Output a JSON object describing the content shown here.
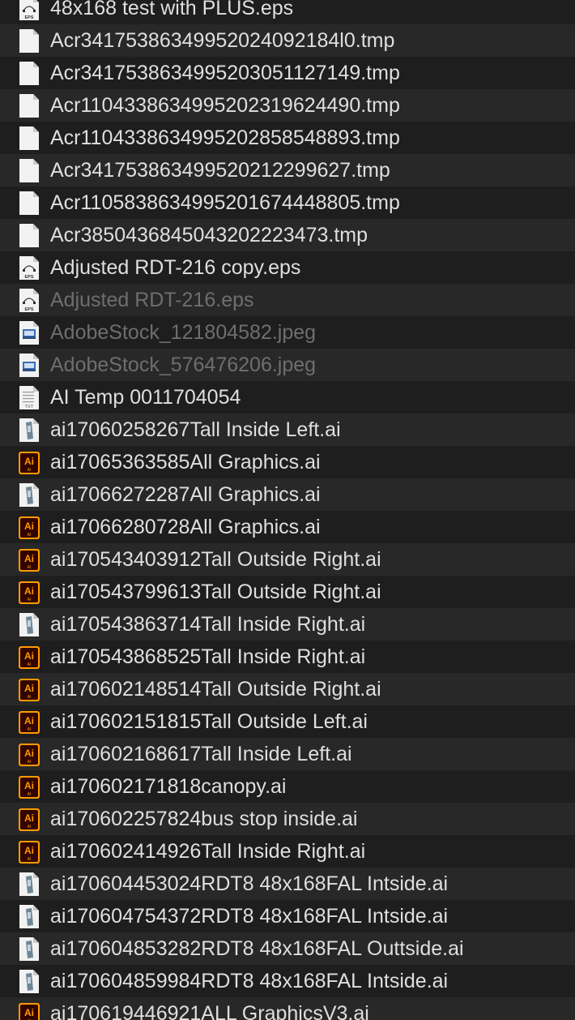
{
  "colors": {
    "background": "#1e1e1e",
    "row_alt": "#282828",
    "text": "#dfdfdf",
    "text_dim": "#6e6e6e",
    "ai_icon_bg": "#310400",
    "ai_icon_accent": "#ff9a00"
  },
  "files": [
    {
      "name": "48x168 test with PLUS.eps",
      "icon": "eps-file-icon",
      "badge": "EPS",
      "dim": false
    },
    {
      "name": "Acr34175386349952024092184l0.tmp",
      "icon": "blank-document-icon",
      "badge": "",
      "dim": false
    },
    {
      "name": "Acr341753863499520305112714​9.tmp",
      "icon": "blank-document-icon",
      "badge": "",
      "dim": false
    },
    {
      "name": "Acr110433863499520231962449​0.tmp",
      "icon": "blank-document-icon",
      "badge": "",
      "dim": false
    },
    {
      "name": "Acr110433863499520285854889​3.tmp",
      "icon": "blank-document-icon",
      "badge": "",
      "dim": false
    },
    {
      "name": "Acr34175386349952021229962​7.tmp",
      "icon": "blank-document-icon",
      "badge": "",
      "dim": false
    },
    {
      "name": "Acr110583863499520167444880​5.tmp",
      "icon": "blank-document-icon",
      "badge": "",
      "dim": false
    },
    {
      "name": "Acr38504368450432022234​73.tmp",
      "icon": "blank-document-icon",
      "badge": "",
      "dim": false
    },
    {
      "name": "Adjusted RDT-216 copy.eps",
      "icon": "eps-file-icon",
      "badge": "EPS",
      "dim": false
    },
    {
      "name": "Adjusted RDT-216.eps",
      "icon": "eps-file-icon",
      "badge": "EPS",
      "dim": true
    },
    {
      "name": "AdobeStock_121804582.jpeg",
      "icon": "image-file-icon",
      "badge": "",
      "dim": true
    },
    {
      "name": "AdobeStock_576476206.jpeg",
      "icon": "image-file-icon",
      "badge": "",
      "dim": true
    },
    {
      "name": "AI Temp 0011704054",
      "icon": "text-file-icon",
      "badge": "TXT",
      "dim": false
    },
    {
      "name": "ai17060258267Tall Inside Left.ai",
      "icon": "ai-thumbnail-icon",
      "badge": "",
      "dim": false
    },
    {
      "name": "ai17065363585All Graphics.ai",
      "icon": "illustrator-file-icon",
      "badge": "Ai",
      "dim": false
    },
    {
      "name": "ai17066272287All Graphics.ai",
      "icon": "ai-thumbnail-icon",
      "badge": "",
      "dim": false
    },
    {
      "name": "ai17066280728All Graphics.ai",
      "icon": "illustrator-file-icon",
      "badge": "Ai",
      "dim": false
    },
    {
      "name": "ai170543403912Tall Outside Right.ai",
      "icon": "illustrator-file-icon",
      "badge": "Ai",
      "dim": false
    },
    {
      "name": "ai170543799613Tall Outside Right.ai",
      "icon": "illustrator-file-icon",
      "badge": "Ai",
      "dim": false
    },
    {
      "name": "ai170543863714Tall Inside Right.ai",
      "icon": "ai-thumbnail-icon",
      "badge": "",
      "dim": false
    },
    {
      "name": "ai170543868525Tall Inside Right.ai",
      "icon": "illustrator-file-icon",
      "badge": "Ai",
      "dim": false
    },
    {
      "name": "ai170602148514Tall Outside Right.ai",
      "icon": "illustrator-file-icon",
      "badge": "Ai",
      "dim": false
    },
    {
      "name": "ai170602151815Tall Outside Left.ai",
      "icon": "illustrator-file-icon",
      "badge": "Ai",
      "dim": false
    },
    {
      "name": "ai170602168617Tall Inside Left.ai",
      "icon": "illustrator-file-icon",
      "badge": "Ai",
      "dim": false
    },
    {
      "name": "ai170602171818canopy.ai",
      "icon": "illustrator-file-icon",
      "badge": "Ai",
      "dim": false
    },
    {
      "name": "ai170602257824bus stop inside.ai",
      "icon": "illustrator-file-icon",
      "badge": "Ai",
      "dim": false
    },
    {
      "name": "ai170602414926Tall Inside Right.ai",
      "icon": "illustrator-file-icon",
      "badge": "Ai",
      "dim": false
    },
    {
      "name": "ai170604453024RDT8 48x168FAL Intside.ai",
      "icon": "ai-thumbnail-icon",
      "badge": "",
      "dim": false
    },
    {
      "name": "ai170604754372RDT8 48x168FAL Intside.ai",
      "icon": "ai-thumbnail-icon",
      "badge": "",
      "dim": false
    },
    {
      "name": "ai170604853282RDT8 48x168FAL Outtside.ai",
      "icon": "ai-thumbnail-icon",
      "badge": "",
      "dim": false
    },
    {
      "name": "ai170604859984RDT8 48x168FAL Intside.ai",
      "icon": "ai-thumbnail-icon",
      "badge": "",
      "dim": false
    },
    {
      "name": "ai170619446921ALL GraphicsV3.ai",
      "icon": "illustrator-file-icon",
      "badge": "Ai",
      "dim": false
    }
  ]
}
